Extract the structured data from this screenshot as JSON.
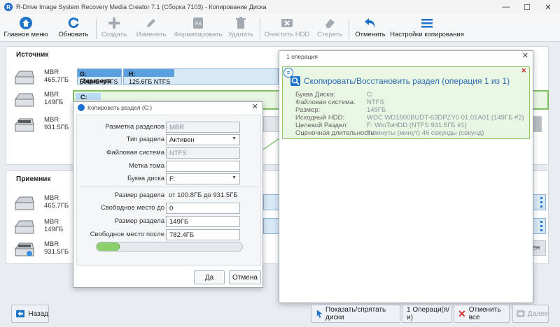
{
  "window": {
    "title": "R-Drive Image System Recovery Media Creator 7.1 (Сборка 7103) - Копирование Диска",
    "app_icon_letter": "R",
    "controls": [
      "—",
      "☐",
      "✕"
    ]
  },
  "toolbar": {
    "items": [
      {
        "label": "Главное меню",
        "icon": "home-icon",
        "enabled": true
      },
      {
        "label": "Обновить",
        "icon": "refresh-icon",
        "enabled": true
      },
      {
        "label": "Создать",
        "icon": "plus-icon",
        "enabled": false
      },
      {
        "label": "Изменить",
        "icon": "pencil-icon",
        "enabled": false
      },
      {
        "label": "Форматировать",
        "icon": "format-icon",
        "enabled": false
      },
      {
        "label": "Удалить",
        "icon": "trash-icon",
        "enabled": false
      },
      {
        "label": "Очистить HDD",
        "icon": "clear-disk-icon",
        "enabled": false
      },
      {
        "label": "Стереть",
        "icon": "eraser-icon",
        "enabled": false
      },
      {
        "label": "Отменить",
        "icon": "undo-icon",
        "enabled": true
      },
      {
        "label": "Настройки копирования",
        "icon": "settings-list-icon",
        "enabled": true
      }
    ]
  },
  "source": {
    "title": "Источник",
    "disks": [
      {
        "scheme": "MBR",
        "size": "465.7ГБ"
      },
      {
        "scheme": "MBR",
        "size": "149ГБ"
      },
      {
        "scheme": "MBR",
        "size": "931.5ГБ"
      }
    ],
    "disk1_partitions": [
      {
        "name": "G: (Зарезерв",
        "info": "500МБ NTFS"
      },
      {
        "name": "H:",
        "info": "125.6ГБ NTFS"
      }
    ],
    "disk2_partition": {
      "name": "C:"
    }
  },
  "target": {
    "title": "Приемник",
    "disks": [
      {
        "scheme": "MBR",
        "size": "465.7ГБ"
      },
      {
        "scheme": "MBR",
        "size": "149ГБ"
      },
      {
        "scheme": "MBR",
        "size": "931.5ГБ"
      }
    ],
    "partial_label": "лен"
  },
  "copy_dialog": {
    "title": "Копировать раздел (C:)",
    "fields": {
      "layout": {
        "label": "Разметка разделов",
        "value": "MBR"
      },
      "type": {
        "label": "Тип раздела",
        "value": "Активен"
      },
      "fs": {
        "label": "Файловая система",
        "value": "NTFS"
      },
      "volume": {
        "label": "Метка тома",
        "value": ""
      },
      "letter": {
        "label": "Буква диска",
        "value": "F:"
      }
    },
    "size_label": "Размер раздела",
    "size_from_word": "от",
    "size_from": "100.8ГБ",
    "size_to_word": "до",
    "size_to": "931.5ГБ",
    "free_before": {
      "label": "Свободное место до",
      "value": "0"
    },
    "part_size": {
      "label": "Размер раздела",
      "value": "149ГБ"
    },
    "free_after": {
      "label": "Свободное место после",
      "value": "782.4ГБ"
    },
    "slider_fraction": 0.16,
    "ok": "Да",
    "cancel": "Отмена"
  },
  "ops_panel": {
    "title": "1 операция",
    "heading": "Скопировать/Восстановить раздел (операция 1 из 1)",
    "rows": [
      {
        "label": "Буква Диска:",
        "value": "C:"
      },
      {
        "label": "Файловая система:",
        "value": "NTFS"
      },
      {
        "label": "Размер:",
        "value": "149ГБ"
      },
      {
        "label": "Исходный HDD:",
        "value": "WDC WD1600BUDT-63DPZY0 01.01A01 (149ГБ #2)"
      },
      {
        "label": "Целевой Раздел:",
        "value": "F: WinToHDD (NTFS 931.5ГБ #1)"
      },
      {
        "label": "Оценочная длительность:",
        "value": "8 минуты (минут) 46 секунды (секунд)"
      }
    ]
  },
  "bottom": {
    "back": "Назад",
    "show_hide": "Показать/спрятать диски",
    "ops_count": "1 Операци(я/и)",
    "cancel_all": "Отменить все",
    "next": "Далее"
  }
}
